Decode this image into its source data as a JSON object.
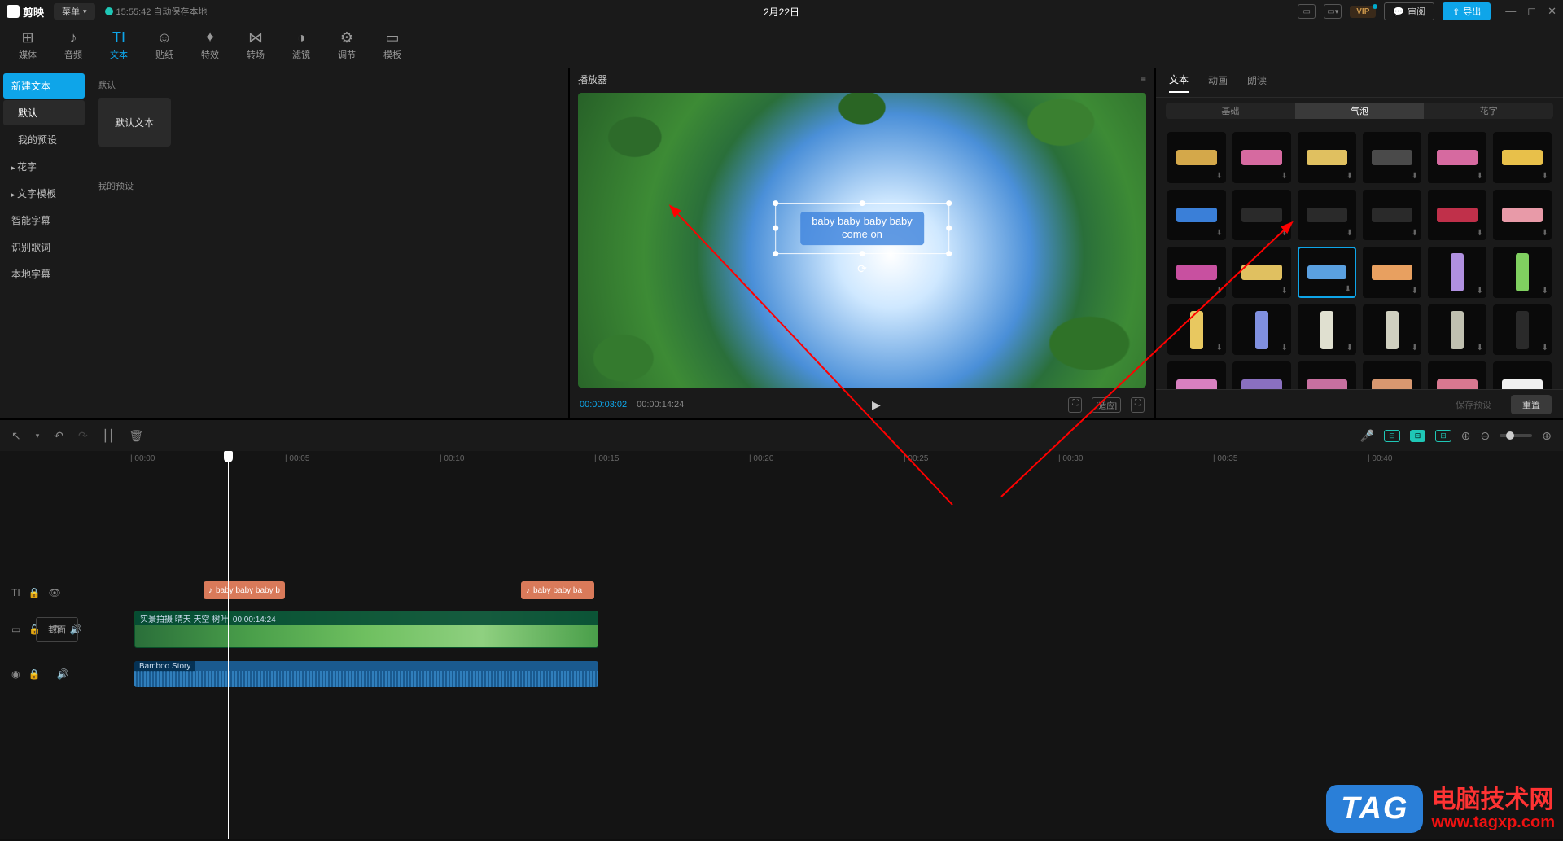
{
  "titlebar": {
    "app_name": "剪映",
    "menu": "菜单",
    "autosave": "15:55:42 自动保存本地",
    "project_title": "2月22日",
    "vip": "VIP",
    "review": "审阅",
    "export": "导出"
  },
  "toolbar": {
    "items": [
      {
        "icon": "⊞",
        "label": "媒体"
      },
      {
        "icon": "♪",
        "label": "音频"
      },
      {
        "icon": "TI",
        "label": "文本"
      },
      {
        "icon": "☺",
        "label": "贴纸"
      },
      {
        "icon": "✦",
        "label": "特效"
      },
      {
        "icon": "⋈",
        "label": "转场"
      },
      {
        "icon": "◑",
        "label": "滤镜"
      },
      {
        "icon": "⚙",
        "label": "调节"
      },
      {
        "icon": "▭",
        "label": "模板"
      }
    ],
    "active_index": 2
  },
  "left": {
    "items": [
      {
        "label": "新建文本",
        "type": "highlight"
      },
      {
        "label": "默认",
        "type": "sub-selected"
      },
      {
        "label": "我的预设",
        "type": "sub"
      },
      {
        "label": "花字",
        "type": "arrow"
      },
      {
        "label": "文字模板",
        "type": "arrow"
      },
      {
        "label": "智能字幕",
        "type": "plain"
      },
      {
        "label": "识别歌词",
        "type": "plain"
      },
      {
        "label": "本地字幕",
        "type": "plain"
      }
    ],
    "section_default": "默认",
    "default_text_card": "默认文本",
    "section_preset": "我的预设"
  },
  "player": {
    "header": "播放器",
    "overlay_line1": "baby baby baby baby",
    "overlay_line2": "come on",
    "time_current": "00:00:03:02",
    "time_duration": "00:00:14:24",
    "ratio": "[适应]"
  },
  "right": {
    "tabs": [
      "文本",
      "动画",
      "朗读"
    ],
    "active_tab": 0,
    "subtabs": [
      "基础",
      "气泡",
      "花字"
    ],
    "active_subtab": 1,
    "save_preset": "保存预设",
    "reset": "重置",
    "bubbles": [
      {
        "bg": "#d4a84a"
      },
      {
        "bg": "#d66aa0"
      },
      {
        "bg": "#e0c060"
      },
      {
        "bg": "#4a4a4a"
      },
      {
        "bg": "#d66aa0"
      },
      {
        "bg": "#e8c04a"
      },
      {
        "bg": "#3a7fd8"
      },
      {
        "bg": "#2a2a2a"
      },
      {
        "bg": "#2a2a2a"
      },
      {
        "bg": "#2a2a2a"
      },
      {
        "bg": "#c0304a"
      },
      {
        "bg": "#e89aa8"
      },
      {
        "bg": "#c850a0"
      },
      {
        "bg": "#e0c060"
      },
      {
        "bg": "#5aa0e0",
        "sel": true
      },
      {
        "bg": "#e8a060"
      },
      {
        "bg": "#b090e0",
        "v": true
      },
      {
        "bg": "#80d060",
        "v": true
      },
      {
        "bg": "#e8c860",
        "v": true
      },
      {
        "bg": "#8090e0",
        "v": true
      },
      {
        "bg": "#e0e0d0",
        "v": true
      },
      {
        "bg": "#d0d0c0",
        "v": true
      },
      {
        "bg": "#c0c0b0",
        "v": true
      },
      {
        "bg": "#2a2a2a",
        "v": true
      },
      {
        "bg": "#d880c0"
      },
      {
        "bg": "#8a70c0"
      },
      {
        "bg": "#c870a0"
      },
      {
        "bg": "#d89870"
      },
      {
        "bg": "#d87890"
      },
      {
        "bg": "#f0f0f0"
      }
    ]
  },
  "timeline": {
    "ticks": [
      "00:00",
      "00:05",
      "00:10",
      "00:15",
      "00:20",
      "00:25",
      "00:30",
      "00:35",
      "00:40"
    ],
    "text_clip_1": "baby baby baby b",
    "text_clip_2": "baby baby ba",
    "cover": "封面",
    "video_label": "实景拍摄 晴天 天空 树叶",
    "video_duration": "00:00:14:24",
    "audio_label": "Bamboo Story"
  },
  "watermark": {
    "tag": "TAG",
    "line1": "电脑技术网",
    "url": "www.tagxp.com"
  }
}
